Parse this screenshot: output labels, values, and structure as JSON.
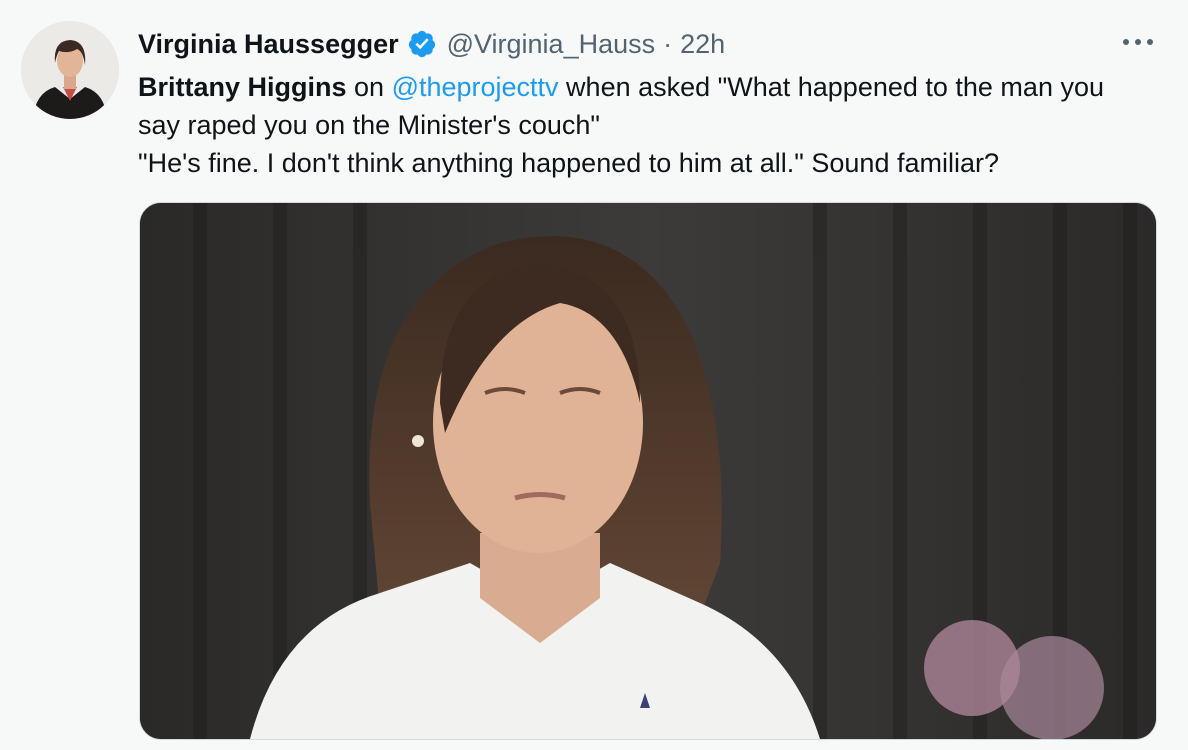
{
  "tweet": {
    "author": {
      "display_name": "Virginia Haussegger",
      "handle": "@Virginia_Hauss",
      "verified": true,
      "avatar_icon": "profile-photo-avatar"
    },
    "separator": "·",
    "timestamp": "22h",
    "more_icon": "more-horizontal-icon",
    "text": {
      "bold_name": "Brittany Higgins",
      "word_on": " on ",
      "mention": "@theprojecttv",
      "rest_line1": " when asked \"What happened to the man you say raped you on the Minister's couch\"",
      "line2": "\"He's fine. I don't think anything happened to him at all.\" Sound familiar?"
    },
    "media": {
      "type": "video-still",
      "icon": "video-thumbnail"
    }
  },
  "colors": {
    "background": "#f7f9f9",
    "link": "#1d9bf0",
    "secondary_text": "#536471",
    "verified_badge": "#1d9bf0"
  }
}
